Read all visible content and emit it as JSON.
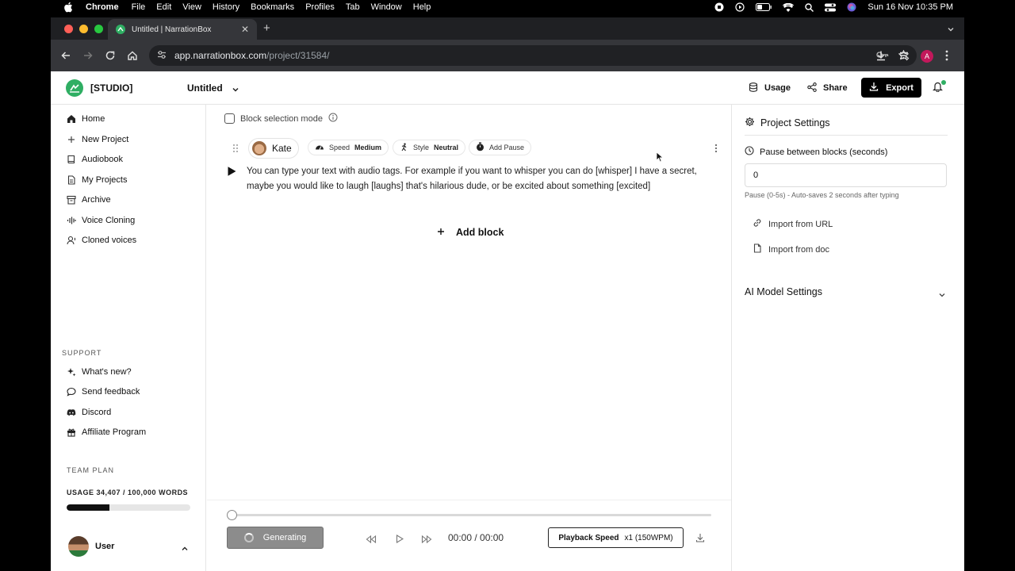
{
  "menubar": {
    "app": "Chrome",
    "items": [
      "File",
      "Edit",
      "View",
      "History",
      "Bookmarks",
      "Profiles",
      "Tab",
      "Window",
      "Help"
    ],
    "datetime": "Sun 16 Nov  10:35 PM"
  },
  "browser": {
    "tab_title": "Untitled | NarrationBox",
    "url_host": "app.narrationbox.com",
    "url_path": "/project/31584/",
    "profile_initial": "A"
  },
  "header": {
    "brand": "[STUDIO]",
    "project_name": "Untitled",
    "usage_label": "Usage",
    "share_label": "Share",
    "export_label": "Export",
    "colors": {
      "brand_green": "#2fae63",
      "primary": "#000000"
    }
  },
  "sidebar": {
    "items": [
      {
        "label": "Home",
        "icon": "home-icon"
      },
      {
        "label": "New Project",
        "icon": "plus-icon"
      },
      {
        "label": "Audiobook",
        "icon": "book-icon"
      },
      {
        "label": "My Projects",
        "icon": "document-icon"
      },
      {
        "label": "Archive",
        "icon": "archive-icon"
      },
      {
        "label": "Voice Cloning",
        "icon": "waveform-icon"
      },
      {
        "label": "Cloned voices",
        "icon": "voice-icon"
      }
    ],
    "support_label": "SUPPORT",
    "support_items": [
      {
        "label": "What's new?",
        "icon": "sparkle-icon"
      },
      {
        "label": "Send feedback",
        "icon": "chat-icon"
      },
      {
        "label": "Discord",
        "icon": "discord-icon"
      },
      {
        "label": "Affiliate Program",
        "icon": "gift-icon"
      }
    ],
    "team_plan_label": "TEAM PLAN",
    "usage_text": "USAGE  34,407 / 100,000 WORDS",
    "usage_fraction": 0.344,
    "user_name": "User"
  },
  "editor": {
    "block_selection_label": "Block selection mode",
    "voice_name": "Kate",
    "speed_label": "Speed",
    "speed_value": "Medium",
    "style_label": "Style",
    "style_value": "Neutral",
    "add_pause_label": "Add Pause",
    "block_text": "You can type your text with audio tags. For example if you want to whisper you can do [whisper] I have a secret, maybe you would like to laugh [laughs] that's hilarious dude, or be excited about something [excited]",
    "add_block_label": "Add block"
  },
  "player": {
    "generating_label": "Generating",
    "time": "00:00 / 00:00",
    "playback_speed_label": "Playback Speed",
    "playback_speed_value": "x1 (150WPM)",
    "progress_fraction": 0
  },
  "settings": {
    "title": "Project Settings",
    "pause_label": "Pause between blocks (seconds)",
    "pause_value": "0",
    "pause_hint": "Pause (0-5s) - Auto-saves 2 seconds after typing",
    "import_url_label": "Import from URL",
    "import_doc_label": "Import from doc",
    "ai_settings_label": "AI Model Settings"
  }
}
